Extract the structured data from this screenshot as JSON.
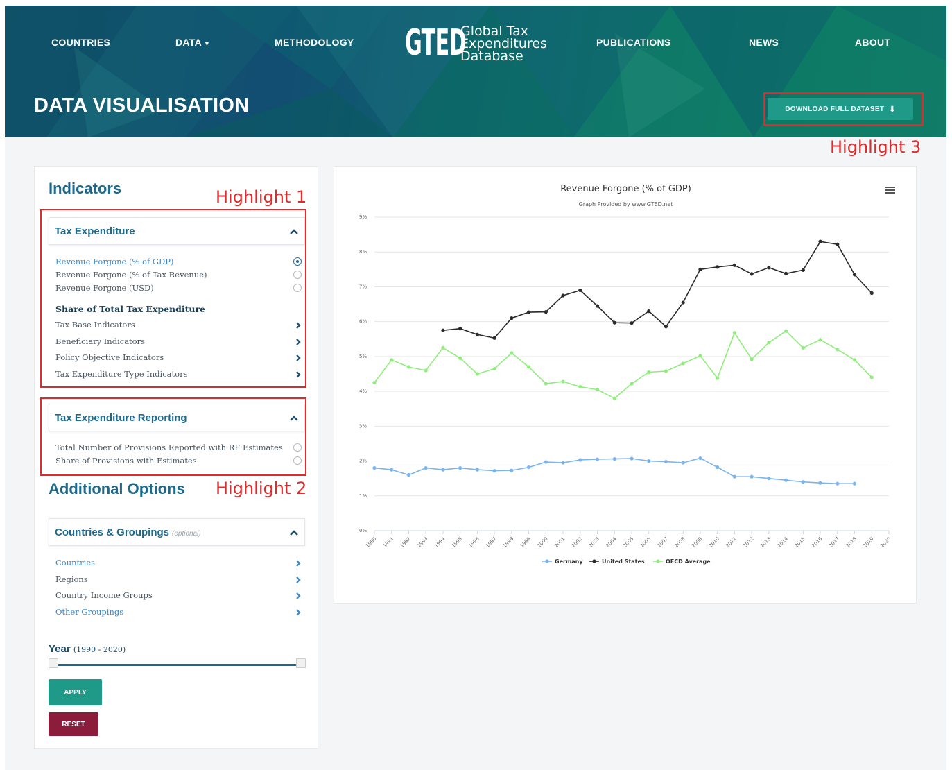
{
  "nav": {
    "countries": "COUNTRIES",
    "data": "DATA",
    "methodology": "METHODOLOGY",
    "publications": "PUBLICATIONS",
    "news": "NEWS",
    "about": "ABOUT"
  },
  "logo": {
    "mark": "GTED",
    "line1": "Global Tax",
    "line2": "Expenditures",
    "line3": "Database"
  },
  "page_title": "DATA VISUALISATION",
  "download_button": "DOWNLOAD FULL DATASET",
  "highlights": {
    "h1": "Highlight 1",
    "h2": "Highlight 2",
    "h3": "Highlight 3"
  },
  "indicators": {
    "heading": "Indicators",
    "tax_expenditure": {
      "title": "Tax Expenditure",
      "options": [
        {
          "label": "Revenue Forgone (% of GDP)",
          "selected": true
        },
        {
          "label": "Revenue Forgone (% of Tax Revenue)",
          "selected": false
        },
        {
          "label": "Revenue Forgone (USD)",
          "selected": false
        }
      ],
      "share_heading": "Share of Total Tax Expenditure",
      "share_items": [
        "Tax Base Indicators",
        "Beneficiary Indicators",
        "Policy Objective Indicators",
        "Tax Expenditure Type Indicators"
      ]
    },
    "reporting": {
      "title": "Tax Expenditure Reporting",
      "options": [
        {
          "label": "Total Number of Provisions Reported with RF Estimates",
          "selected": false
        },
        {
          "label": "Share of Provisions with Estimates",
          "selected": false
        }
      ]
    }
  },
  "additional": {
    "heading": "Additional Options",
    "countries_groupings": {
      "title": "Countries & Groupings",
      "optional": "(optional)",
      "items": [
        "Countries",
        "Regions",
        "Country Income Groups",
        "Other Groupings"
      ]
    },
    "year": {
      "label": "Year",
      "range": "(1990 - 2020)",
      "min": 1990,
      "max": 2020
    },
    "apply": "APPLY",
    "reset": "RESET"
  },
  "chart_data": {
    "type": "line",
    "title": "Revenue Forgone (% of GDP)",
    "subtitle": "Graph Provided by www.GTED.net",
    "x": [
      1990,
      1991,
      1992,
      1993,
      1994,
      1995,
      1996,
      1997,
      1998,
      1999,
      2000,
      2001,
      2002,
      2003,
      2004,
      2005,
      2006,
      2007,
      2008,
      2009,
      2010,
      2011,
      2012,
      2013,
      2014,
      2015,
      2016,
      2017,
      2018,
      2019,
      2020
    ],
    "x_tick_labels": [
      "1990",
      "1991",
      "1992",
      "1993",
      "1994",
      "1995",
      "1996",
      "1997",
      "1998",
      "1999",
      "2000",
      "2001",
      "2002",
      "2003",
      "2004",
      "2005",
      "2006",
      "2007",
      "2008",
      "2009",
      "2010",
      "2011",
      "2012",
      "2013",
      "2014",
      "2015",
      "2016",
      "2017",
      "2018",
      "2019",
      "2020"
    ],
    "y_ticks": [
      "0%",
      "1%",
      "2%",
      "3%",
      "4%",
      "5%",
      "6%",
      "7%",
      "8%",
      "9%"
    ],
    "ylim": [
      0,
      9
    ],
    "grid": true,
    "legend_position": "bottom",
    "series": [
      {
        "name": "Germany",
        "color": "#7cb5ec",
        "values": [
          1.8,
          1.75,
          1.6,
          1.8,
          1.75,
          1.8,
          1.75,
          1.72,
          1.73,
          1.82,
          1.97,
          1.95,
          2.03,
          2.05,
          2.06,
          2.07,
          2.0,
          1.98,
          1.95,
          2.08,
          1.82,
          1.55,
          1.55,
          1.5,
          1.45,
          1.4,
          1.37,
          1.35,
          1.35,
          null,
          null
        ]
      },
      {
        "name": "United States",
        "color": "#2b2b2b",
        "values": [
          null,
          null,
          null,
          null,
          5.75,
          5.8,
          5.63,
          5.53,
          6.1,
          6.27,
          6.28,
          6.75,
          6.9,
          6.45,
          5.97,
          5.96,
          6.3,
          5.86,
          6.55,
          7.5,
          7.57,
          7.62,
          7.37,
          7.55,
          7.38,
          7.48,
          8.3,
          8.22,
          7.35,
          6.82,
          null
        ]
      },
      {
        "name": "OECD Average",
        "color": "#90ed7d",
        "values": [
          4.25,
          4.9,
          4.7,
          4.6,
          5.25,
          4.95,
          4.5,
          4.65,
          5.1,
          4.7,
          4.22,
          4.28,
          4.13,
          4.05,
          3.8,
          4.22,
          4.55,
          4.58,
          4.8,
          5.02,
          4.38,
          5.68,
          4.92,
          5.4,
          5.73,
          5.25,
          5.48,
          5.2,
          4.9,
          4.4,
          null
        ]
      }
    ]
  }
}
